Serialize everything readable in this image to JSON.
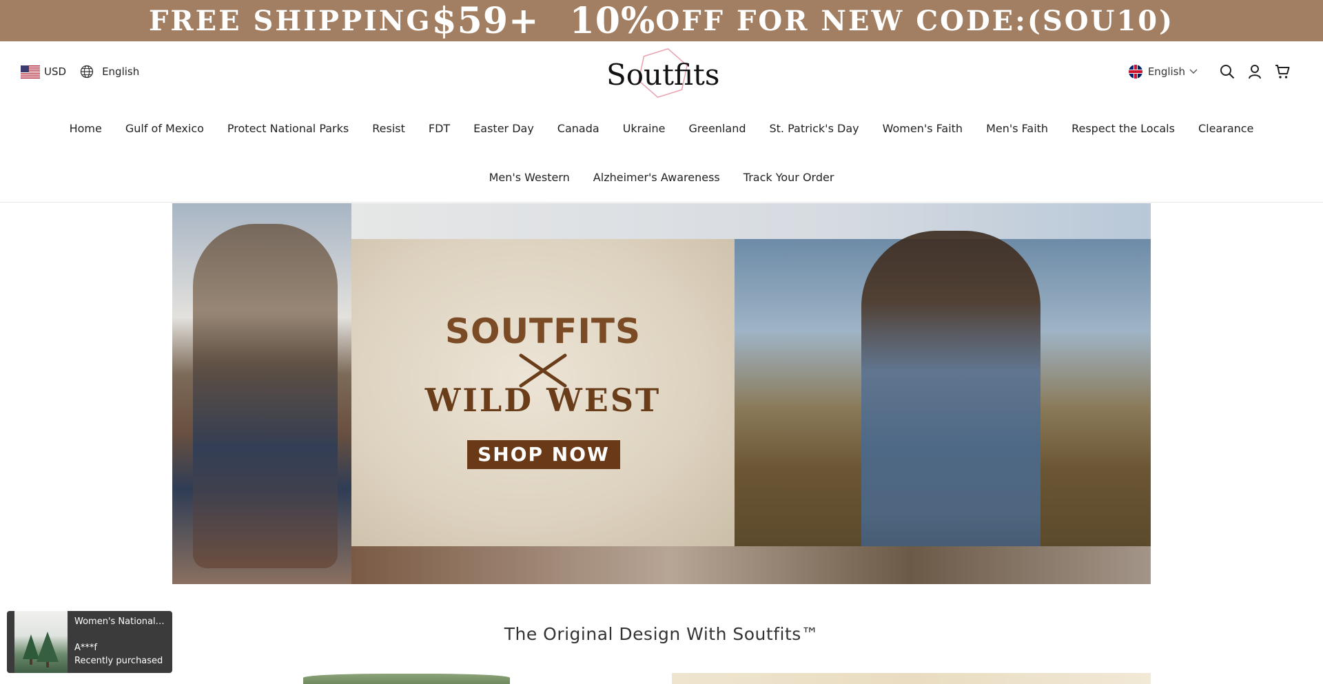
{
  "announcement": {
    "part1": "FREE SHIPPING ",
    "part2": "$59+",
    "part3": "10%",
    "part4": " OFF FOR NEW CODE:(SOU10)"
  },
  "header": {
    "currency": "USD",
    "language_left": "English",
    "logo_text": "Soutfits",
    "language_right": "English",
    "icons": [
      "globe-icon",
      "search-icon",
      "account-icon",
      "cart-icon",
      "chevron-down-icon"
    ]
  },
  "nav": {
    "row1": [
      "Home",
      "Gulf of Mexico",
      "Protect National Parks",
      "Resist",
      "FDT",
      "Easter Day",
      "Canada",
      "Ukraine",
      "Greenland",
      "St. Patrick's Day",
      "Women's Faith",
      "Men's Faith",
      "Respect the Locals",
      "Clearance"
    ],
    "row2": [
      "Men's Western",
      "Alzheimer's Awareness",
      "Track Your Order"
    ]
  },
  "hero": {
    "brand": "SOUTFITS",
    "subtitle": "WILD WEST",
    "cta": "SHOP NOW"
  },
  "section": {
    "title": "The Original Design With Soutfits™"
  },
  "popup": {
    "product": "Women's National ...",
    "customer": "A***f",
    "status": "Recently purchased"
  },
  "colors": {
    "announcement_bg": "#a27f62",
    "cta_bg": "#6a3a18",
    "popup_bg": "#3b3b3b"
  }
}
